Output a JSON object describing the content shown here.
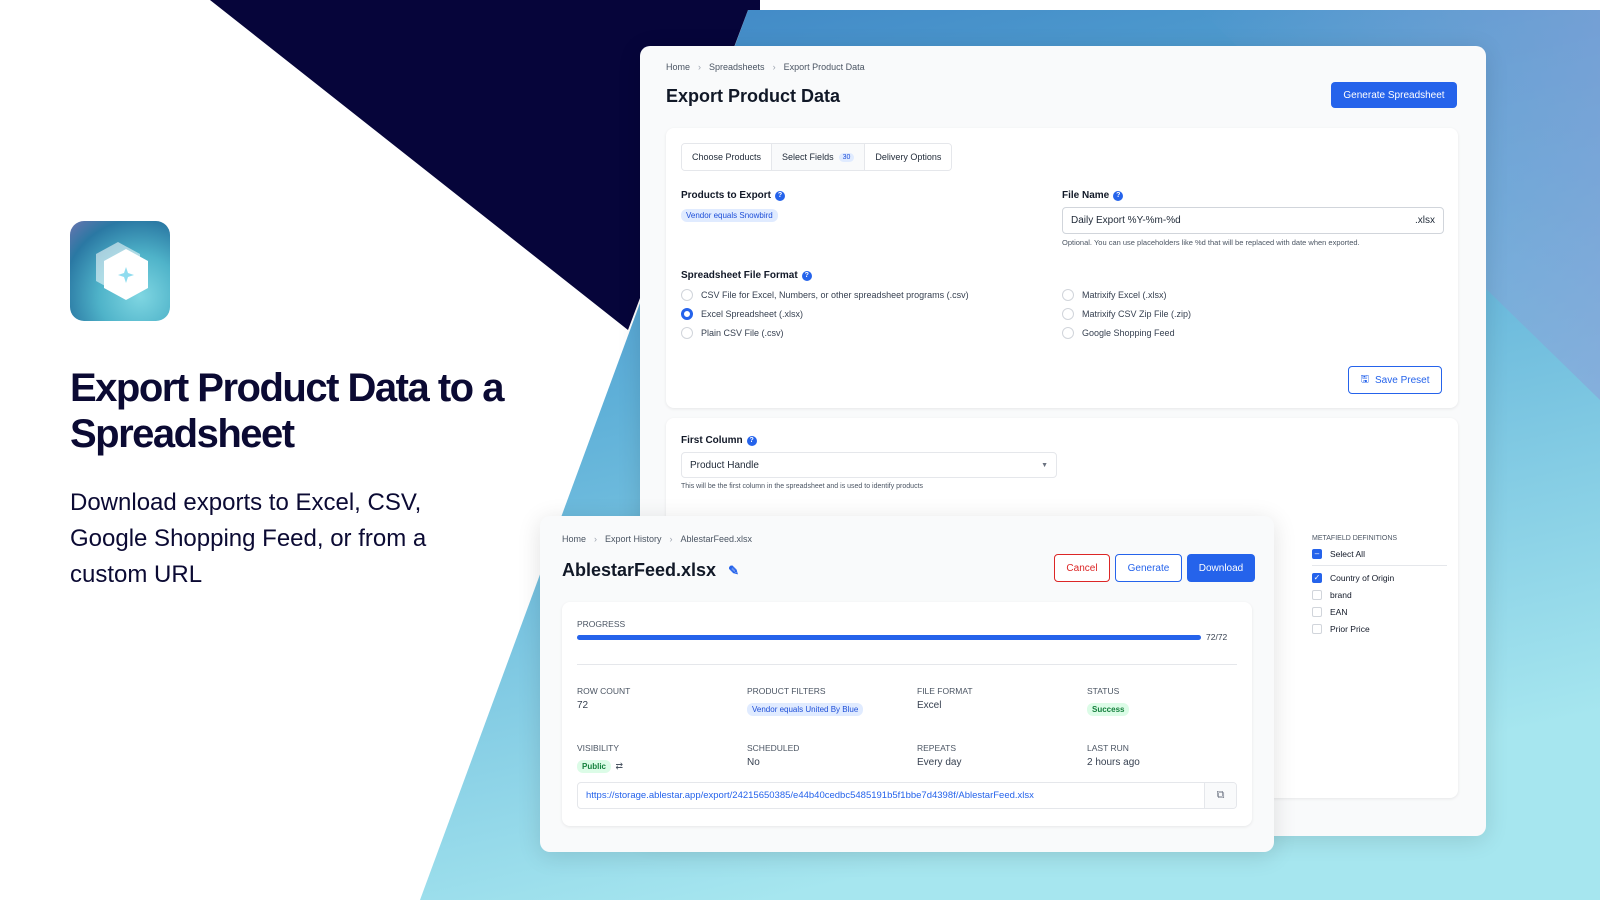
{
  "colors": {
    "accent": "#2563eb",
    "navy": "#0b0a33",
    "success": "#15803d",
    "danger": "#dc2626"
  },
  "hero": {
    "title": "Export Product Data to a Spreadsheet",
    "subtitle": "Download exports to Excel, CSV, Google Shopping Feed, or from a custom URL",
    "logo_icon": "hexagon-sparkle-icon"
  },
  "export_page": {
    "breadcrumb": [
      "Home",
      "Spreadsheets",
      "Export Product Data"
    ],
    "title": "Export Product Data",
    "generate_button": "Generate Spreadsheet",
    "tabs": [
      {
        "label": "Choose Products"
      },
      {
        "label": "Select Fields",
        "badge": "30"
      },
      {
        "label": "Delivery Options"
      }
    ],
    "products_label": "Products to Export",
    "products_filter": "Vendor equals Snowbird",
    "file_name_label": "File Name",
    "file_name_value": "Daily Export %Y-%m-%d",
    "file_name_suffix": ".xlsx",
    "file_name_help": "Optional. You can use placeholders like %d that will be replaced with date when exported.",
    "format_label": "Spreadsheet File Format",
    "formats_left": [
      {
        "label": "CSV File for Excel, Numbers, or other spreadsheet programs (.csv)",
        "selected": false
      },
      {
        "label": "Excel Spreadsheet (.xlsx)",
        "selected": true
      },
      {
        "label": "Plain CSV File (.csv)",
        "selected": false
      }
    ],
    "formats_right": [
      {
        "label": "Matrixify Excel (.xlsx)",
        "selected": false
      },
      {
        "label": "Matrixify CSV Zip File (.zip)",
        "selected": false
      },
      {
        "label": "Google Shopping Feed",
        "selected": false
      }
    ],
    "save_preset": "Save Preset",
    "first_column_label": "First Column",
    "first_column_value": "Product Handle",
    "first_column_help": "This will be the first column in the spreadsheet and is used to identify products",
    "metafield_heading": "METAFIELD DEFINITIONS",
    "select_all": "Select All",
    "metafields": [
      {
        "label": "Country of Origin",
        "checked": true
      },
      {
        "label": "brand",
        "checked": false
      },
      {
        "label": "EAN",
        "checked": false
      },
      {
        "label": "Prior Price",
        "checked": false
      }
    ]
  },
  "history_page": {
    "breadcrumb": [
      "Home",
      "Export History",
      "AblestarFeed.xlsx"
    ],
    "title": "AblestarFeed.xlsx",
    "cancel": "Cancel",
    "generate": "Generate",
    "download": "Download",
    "progress_label": "PROGRESS",
    "progress_text": "72/72",
    "progress_percent": 100,
    "meta": [
      {
        "key": "ROW COUNT",
        "value": "72"
      },
      {
        "key": "PRODUCT FILTERS",
        "value": "Vendor equals United By Blue",
        "type": "chip"
      },
      {
        "key": "FILE FORMAT",
        "value": "Excel"
      },
      {
        "key": "STATUS",
        "value": "Success",
        "type": "success"
      },
      {
        "key": "VISIBILITY",
        "value": "Public",
        "type": "public"
      },
      {
        "key": "SCHEDULED",
        "value": "No"
      },
      {
        "key": "REPEATS",
        "value": "Every day"
      },
      {
        "key": "LAST RUN",
        "value": "2 hours ago"
      }
    ],
    "url": "https://storage.ablestar.app/export/24215650385/e44b40cedbc5485191b5f1bbe7d4398f/AblestarFeed.xlsx"
  }
}
